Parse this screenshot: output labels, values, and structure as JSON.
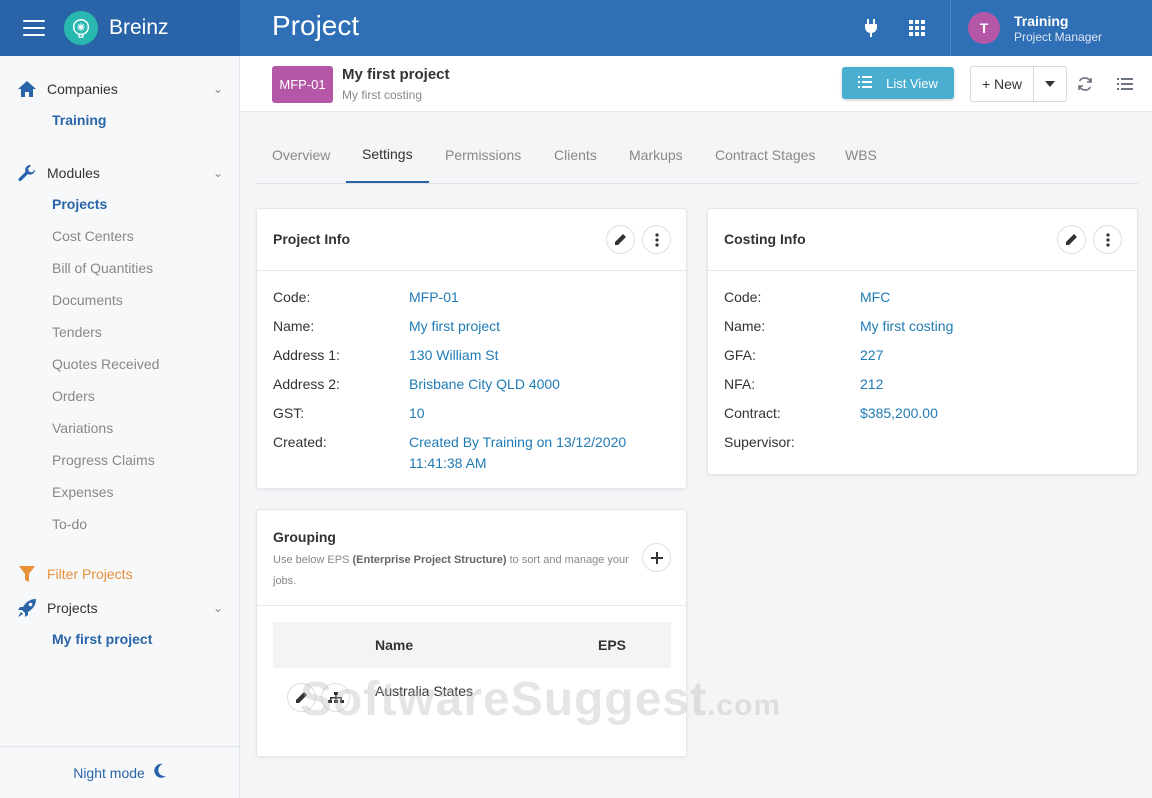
{
  "app": {
    "brand": "Breinz",
    "page_title": "Project"
  },
  "user": {
    "initial": "T",
    "name": "Training",
    "role": "Project Manager"
  },
  "sidebar": {
    "companies": {
      "label": "Companies",
      "items": [
        "Training"
      ]
    },
    "modules": {
      "label": "Modules",
      "items": [
        "Projects",
        "Cost Centers",
        "Bill of Quantities",
        "Documents",
        "Tenders",
        "Quotes Received",
        "Orders",
        "Variations",
        "Progress Claims",
        "Expenses",
        "To-do"
      ]
    },
    "filter_label": "Filter Projects",
    "projects": {
      "label": "Projects",
      "items": [
        "My first project"
      ]
    },
    "night_mode": "Night mode"
  },
  "project": {
    "code": "MFP-01",
    "name": "My first project",
    "subtitle": "My first costing"
  },
  "toolbar": {
    "list_view": "List View",
    "new": "+ New"
  },
  "tabs": [
    "Overview",
    "Settings",
    "Permissions",
    "Clients",
    "Markups",
    "Contract Stages",
    "WBS"
  ],
  "project_info": {
    "title": "Project Info",
    "fields": [
      {
        "label": "Code:",
        "value": "MFP-01"
      },
      {
        "label": "Name:",
        "value": "My first project"
      },
      {
        "label": "Address 1:",
        "value": "130 William St"
      },
      {
        "label": "Address 2:",
        "value": "Brisbane City QLD 4000"
      },
      {
        "label": "GST:",
        "value": "10"
      },
      {
        "label": "Created:",
        "value": "Created By Training on 13/12/2020",
        "value2": "11:41:38 AM"
      }
    ]
  },
  "costing_info": {
    "title": "Costing Info",
    "fields": [
      {
        "label": "Code:",
        "value": "MFC"
      },
      {
        "label": "Name:",
        "value": "My first costing"
      },
      {
        "label": "GFA:",
        "value": "227"
      },
      {
        "label": "NFA:",
        "value": "212"
      },
      {
        "label": "Contract:",
        "value": "$385,200.00"
      },
      {
        "label": "Supervisor:",
        "value": ""
      }
    ]
  },
  "grouping": {
    "title": "Grouping",
    "desc_pre": "Use below EPS ",
    "desc_bold": "(Enterprise Project Structure)",
    "desc_post": " to sort and manage your jobs.",
    "columns": [
      "Name",
      "EPS"
    ],
    "rows": [
      {
        "name": "Australia States",
        "eps": ""
      }
    ]
  },
  "watermark": {
    "main": "SoftwareSuggest",
    "suffix": ".com"
  },
  "colors": {
    "header": "#2f6fb6",
    "brand_bg": "#2a64a8",
    "accent_purple": "#b457a6",
    "link_blue": "#1f7bb5",
    "list_view": "#4aaed1",
    "filter_orange": "#e8913a"
  }
}
